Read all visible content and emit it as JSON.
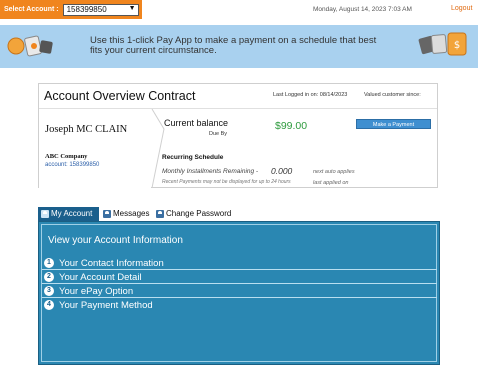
{
  "topbar": {
    "select_label": "Select Account :",
    "account_selected": "158399850",
    "datetime": "Monday, August 14, 2023 7:03 AM",
    "logout": "Logout"
  },
  "banner": {
    "text": "Use this 1-click Pay App to make a payment on a schedule that best fits your current circumstance."
  },
  "overview": {
    "title": "Account Overview Contract",
    "last_logged_in": "Last Logged in on: 08/14/2023",
    "valued_since": "Valued customer since:",
    "customer_name": "Joseph MC CLAIN",
    "company": "ABC Company",
    "account_line": "account: 158399850",
    "current_balance_label": "Current balance",
    "due_by_label": "Due By",
    "balance_amount": "$99.00",
    "make_payment": "Make a Payment",
    "recurring_title": "Recurring Schedule",
    "installments_label": "Monthly Installments Remaining -",
    "installments_count": "0.000",
    "next_auto": "next auto applies",
    "note": "Recent Payments may not be displayed for up to 24 hours",
    "last_applied": "last applied on"
  },
  "tabs": [
    {
      "label": "My Account",
      "active": true
    },
    {
      "label": "Messages",
      "active": false
    },
    {
      "label": "Change Password",
      "active": false
    }
  ],
  "panel": {
    "title": "View your Account Information",
    "items": [
      {
        "num": "1",
        "label": "Your Contact Information"
      },
      {
        "num": "2",
        "label": "Your Account Detail"
      },
      {
        "num": "3",
        "label": "Your ePay Option"
      },
      {
        "num": "4",
        "label": "Your Payment Method"
      }
    ]
  },
  "colors": {
    "accent_orange": "#f0851e",
    "banner_blue": "#a9d1ef",
    "panel_blue": "#2a87b2",
    "tab_active": "#1a5f8c",
    "balance_green": "#2e9b3e"
  }
}
